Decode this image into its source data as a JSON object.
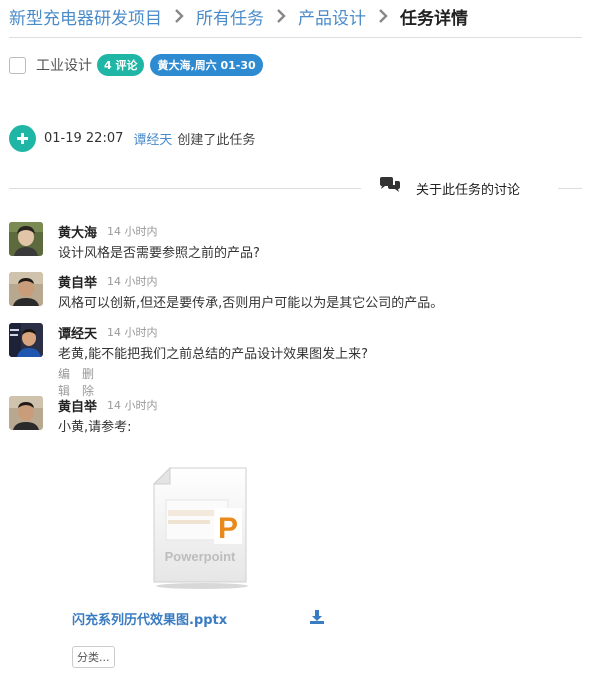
{
  "breadcrumb": {
    "items": [
      "新型充电器研发项目",
      "所有任务",
      "产品设计"
    ],
    "current": "任务详情"
  },
  "task": {
    "title": "工业设计",
    "comment_badge": "4 评论",
    "assignee_badge": "黄大海,周六 01-30"
  },
  "activity": {
    "time": "01-19 22:07",
    "user": "谭经天",
    "text": "创建了此任务"
  },
  "discussion": {
    "title": "关于此任务的讨论"
  },
  "comments": [
    {
      "name": "黄大海",
      "time": "14 小时内",
      "body": "设计风格是否需要参照之前的产品?"
    },
    {
      "name": "黄自举",
      "time": "14 小时内",
      "body": "风格可以创新,但还是要传承,否则用户可能以为是其它公司的产品。"
    },
    {
      "name": "谭经天",
      "time": "14 小时内",
      "body": "老黄,能不能把我们之前总结的产品设计效果图发上来?",
      "actions": {
        "edit": "编辑",
        "delete": "删除"
      }
    },
    {
      "name": "黄自举",
      "time": "14 小时内",
      "body": "小黄,请参考:"
    }
  ],
  "attachment": {
    "thumb_letter": "P",
    "thumb_label": "Powerpoint",
    "file_name": "闪充系列历代效果图.pptx",
    "category_label": "分类..."
  },
  "colors": {
    "link": "#4a8bc9",
    "teal": "#1fb6a6",
    "blue_badge": "#2e8bd1",
    "ppt_orange": "#e8891a"
  },
  "icons": {
    "breadcrumb_separator": "chevron-right-icon",
    "plus": "plus-icon",
    "discussion": "chat-bubbles-icon",
    "download": "download-icon"
  }
}
